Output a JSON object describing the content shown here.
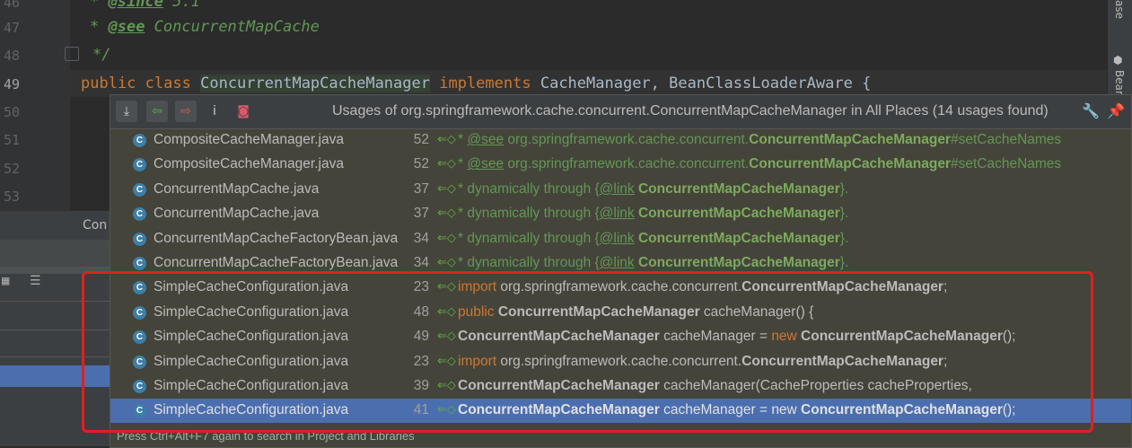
{
  "editor": {
    "line_numbers": [
      "46",
      "47",
      "48",
      "49",
      "50",
      "51",
      "52",
      "53"
    ],
    "lines": {
      "l46_prefix": "* ",
      "l46_tag": "@since",
      "l46_rest": " 5.1",
      "l47_prefix": "* ",
      "l47_tag": "@see",
      "l47_rest": " ConcurrentMapCache",
      "l48": "*/",
      "l49_kw1": "public",
      "l49_kw2": "class",
      "l49_cls": "ConcurrentMapCacheManager",
      "l49_kw3": "implements",
      "l49_rest": "CacheManager, BeanClassLoaderAware {"
    }
  },
  "right_strip": {
    "label_top": "ase",
    "label_bottom": "Bear"
  },
  "left_panel": {
    "tab_label": "Con"
  },
  "popup": {
    "title": "Usages of org.springframework.cache.concurrent.ConcurrentMapCacheManager in All Places (14 usages found)",
    "status": "Press Ctrl+Alt+F7 again to search in Project and Libraries",
    "toolbar_icons": [
      "merge-usages-icon",
      "previous-occurrence-icon",
      "next-occurrence-icon",
      "info-icon",
      "filter-icon"
    ],
    "rows": [
      {
        "file": "CompositeCacheManager.java",
        "line": "52",
        "kind": "doc",
        "pre": "* ",
        "tag": "@see",
        "mid": " org.springframework.cache.concurrent.",
        "hl": "ConcurrentMapCacheManager",
        "post": "#setCacheNames"
      },
      {
        "file": "CompositeCacheManager.java",
        "line": "52",
        "kind": "doc",
        "pre": "* ",
        "tag": "@see",
        "mid": " org.springframework.cache.concurrent.",
        "hl": "ConcurrentMapCacheManager",
        "post": "#setCacheNames"
      },
      {
        "file": "ConcurrentMapCache.java",
        "line": "37",
        "kind": "doc",
        "pre": "* dynamically through {",
        "tag": "@link",
        "mid": " ",
        "hl": "ConcurrentMapCacheManager",
        "post": "}."
      },
      {
        "file": "ConcurrentMapCache.java",
        "line": "37",
        "kind": "doc",
        "pre": "* dynamically through {",
        "tag": "@link",
        "mid": " ",
        "hl": "ConcurrentMapCacheManager",
        "post": "}."
      },
      {
        "file": "ConcurrentMapCacheFactoryBean.java",
        "line": "34",
        "kind": "doc",
        "pre": "* dynamically through {",
        "tag": "@link",
        "mid": " ",
        "hl": "ConcurrentMapCacheManager",
        "post": "}."
      },
      {
        "file": "ConcurrentMapCacheFactoryBean.java",
        "line": "34",
        "kind": "doc",
        "pre": "* dynamically through {",
        "tag": "@link",
        "mid": " ",
        "hl": "ConcurrentMapCacheManager",
        "post": "}."
      },
      {
        "file": "SimpleCacheConfiguration.java",
        "line": "23",
        "kind": "code",
        "kw": "import",
        "mid": " org.springframework.cache.concurrent.",
        "hl": "ConcurrentMapCacheManager",
        "mid2": "",
        "kw2": "",
        "hl2": "",
        "post": ";"
      },
      {
        "file": "SimpleCacheConfiguration.java",
        "line": "48",
        "kind": "code",
        "kw": "public",
        "mid": " ",
        "hl": "ConcurrentMapCacheManager",
        "mid2": " cacheManager() {",
        "kw2": "",
        "hl2": "",
        "post": ""
      },
      {
        "file": "SimpleCacheConfiguration.java",
        "line": "49",
        "kind": "code",
        "kw": "",
        "mid": "",
        "hl": "ConcurrentMapCacheManager",
        "mid2": " cacheManager = ",
        "kw2": "new",
        "hl2": " ConcurrentMapCacheManager",
        "post": "();"
      },
      {
        "file": "SimpleCacheConfiguration.java",
        "line": "23",
        "kind": "code",
        "kw": "import",
        "mid": " org.springframework.cache.concurrent.",
        "hl": "ConcurrentMapCacheManager",
        "mid2": "",
        "kw2": "",
        "hl2": "",
        "post": ";"
      },
      {
        "file": "SimpleCacheConfiguration.java",
        "line": "39",
        "kind": "code",
        "kw": "",
        "mid": "",
        "hl": "ConcurrentMapCacheManager",
        "mid2": " cacheManager(CacheProperties cacheProperties,",
        "kw2": "",
        "hl2": "",
        "post": ""
      },
      {
        "file": "SimpleCacheConfiguration.java",
        "line": "41",
        "kind": "code",
        "kw": "",
        "mid": "",
        "hl": "ConcurrentMapCacheManager",
        "mid2": " cacheManager = ",
        "kw2": "new",
        "hl2": " ConcurrentMapCacheManager",
        "post": "();",
        "selected": true
      }
    ]
  },
  "colors": {
    "selection": "#4b6eaf",
    "highlight_box": "#e02020",
    "keyword": "#cc7832",
    "doc": "#629755"
  }
}
